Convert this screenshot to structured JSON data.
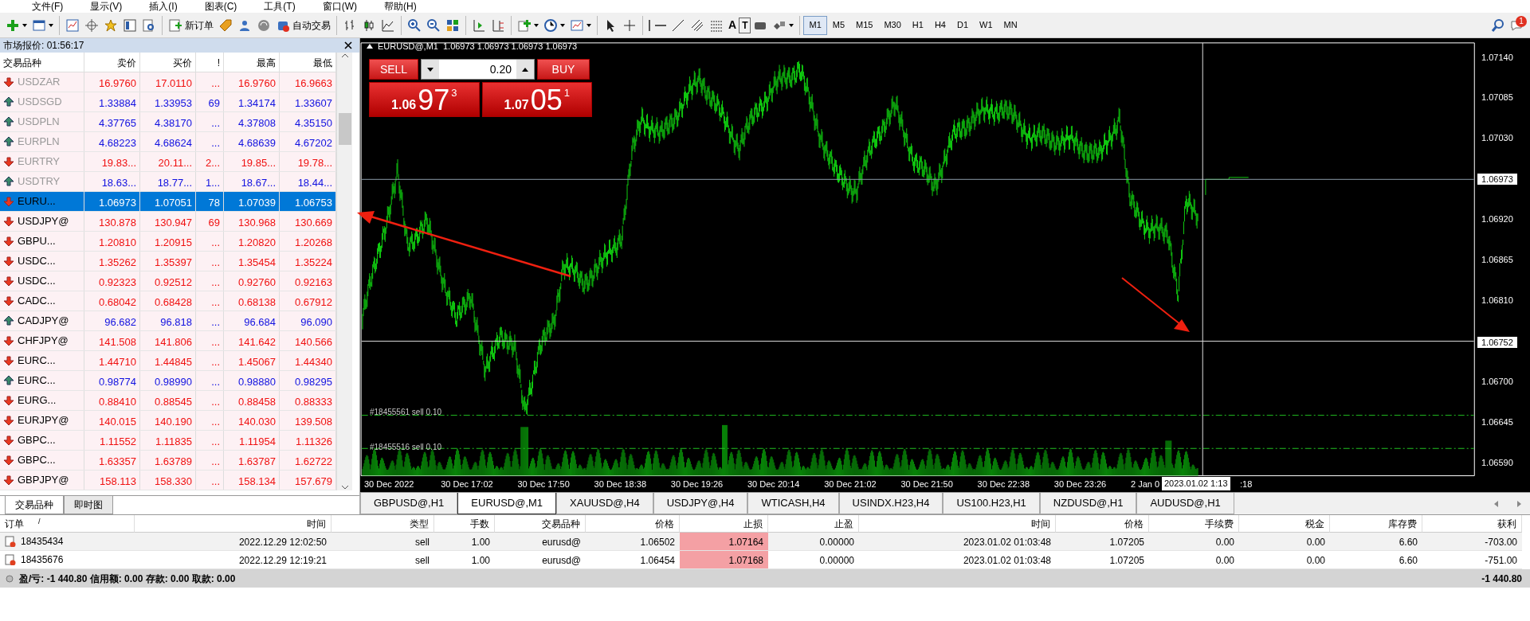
{
  "menu": [
    "文件(F)",
    "显示(V)",
    "插入(I)",
    "图表(C)",
    "工具(T)",
    "窗口(W)",
    "帮助(H)"
  ],
  "toolbar": {
    "new_order": "新订单",
    "auto_trading": "自动交易",
    "text_tool": "A",
    "text_label_tool": "T",
    "notification_count": "1",
    "periods": [
      {
        "label": "M1",
        "selected": true
      },
      {
        "label": "M5",
        "selected": false
      },
      {
        "label": "M15",
        "selected": false
      },
      {
        "label": "M30",
        "selected": false
      },
      {
        "label": "H1",
        "selected": false
      },
      {
        "label": "H4",
        "selected": false
      },
      {
        "label": "D1",
        "selected": false
      },
      {
        "label": "W1",
        "selected": false
      },
      {
        "label": "MN",
        "selected": false
      }
    ]
  },
  "market_watch": {
    "title": "市场报价: 01:56:17",
    "columns": [
      "交易品种",
      "卖价",
      "买价",
      "!",
      "最高",
      "最低"
    ],
    "rows": [
      {
        "symbol": "USDZAR",
        "bid": "16.9760",
        "ask": "17.0110",
        "spread": "...",
        "high": "16.9760",
        "low": "16.9663",
        "rising": false,
        "greyed": true,
        "selected": false
      },
      {
        "symbol": "USDSGD",
        "bid": "1.33884",
        "ask": "1.33953",
        "spread": "69",
        "high": "1.34174",
        "low": "1.33607",
        "rising": true,
        "greyed": true,
        "selected": false
      },
      {
        "symbol": "USDPLN",
        "bid": "4.37765",
        "ask": "4.38170",
        "spread": "...",
        "high": "4.37808",
        "low": "4.35150",
        "rising": true,
        "greyed": true,
        "selected": false
      },
      {
        "symbol": "EURPLN",
        "bid": "4.68223",
        "ask": "4.68624",
        "spread": "...",
        "high": "4.68639",
        "low": "4.67202",
        "rising": true,
        "greyed": true,
        "selected": false
      },
      {
        "symbol": "EURTRY",
        "bid": "19.83...",
        "ask": "20.11...",
        "spread": "2...",
        "high": "19.85...",
        "low": "19.78...",
        "rising": false,
        "greyed": true,
        "selected": false
      },
      {
        "symbol": "USDTRY",
        "bid": "18.63...",
        "ask": "18.77...",
        "spread": "1...",
        "high": "18.67...",
        "low": "18.44...",
        "rising": true,
        "greyed": true,
        "selected": false
      },
      {
        "symbol": "EURU...",
        "bid": "1.06973",
        "ask": "1.07051",
        "spread": "78",
        "high": "1.07039",
        "low": "1.06753",
        "rising": false,
        "greyed": false,
        "selected": true
      },
      {
        "symbol": "USDJPY@",
        "bid": "130.878",
        "ask": "130.947",
        "spread": "69",
        "high": "130.968",
        "low": "130.669",
        "rising": false,
        "greyed": false,
        "selected": false
      },
      {
        "symbol": "GBPU...",
        "bid": "1.20810",
        "ask": "1.20915",
        "spread": "...",
        "high": "1.20820",
        "low": "1.20268",
        "rising": false,
        "greyed": false,
        "selected": false
      },
      {
        "symbol": "USDC...",
        "bid": "1.35262",
        "ask": "1.35397",
        "spread": "...",
        "high": "1.35454",
        "low": "1.35224",
        "rising": false,
        "greyed": false,
        "selected": false
      },
      {
        "symbol": "USDC...",
        "bid": "0.92323",
        "ask": "0.92512",
        "spread": "...",
        "high": "0.92760",
        "low": "0.92163",
        "rising": false,
        "greyed": false,
        "selected": false
      },
      {
        "symbol": "CADC...",
        "bid": "0.68042",
        "ask": "0.68428",
        "spread": "...",
        "high": "0.68138",
        "low": "0.67912",
        "rising": false,
        "greyed": false,
        "selected": false
      },
      {
        "symbol": "CADJPY@",
        "bid": "96.682",
        "ask": "96.818",
        "spread": "...",
        "high": "96.684",
        "low": "96.090",
        "rising": true,
        "greyed": false,
        "selected": false
      },
      {
        "symbol": "CHFJPY@",
        "bid": "141.508",
        "ask": "141.806",
        "spread": "...",
        "high": "141.642",
        "low": "140.566",
        "rising": false,
        "greyed": false,
        "selected": false
      },
      {
        "symbol": "EURC...",
        "bid": "1.44710",
        "ask": "1.44845",
        "spread": "...",
        "high": "1.45067",
        "low": "1.44340",
        "rising": false,
        "greyed": false,
        "selected": false
      },
      {
        "symbol": "EURC...",
        "bid": "0.98774",
        "ask": "0.98990",
        "spread": "...",
        "high": "0.98880",
        "low": "0.98295",
        "rising": true,
        "greyed": false,
        "selected": false
      },
      {
        "symbol": "EURG...",
        "bid": "0.88410",
        "ask": "0.88545",
        "spread": "...",
        "high": "0.88458",
        "low": "0.88333",
        "rising": false,
        "greyed": false,
        "selected": false
      },
      {
        "symbol": "EURJPY@",
        "bid": "140.015",
        "ask": "140.190",
        "spread": "...",
        "high": "140.030",
        "low": "139.508",
        "rising": false,
        "greyed": false,
        "selected": false
      },
      {
        "symbol": "GBPC...",
        "bid": "1.11552",
        "ask": "1.11835",
        "spread": "...",
        "high": "1.11954",
        "low": "1.11326",
        "rising": false,
        "greyed": false,
        "selected": false
      },
      {
        "symbol": "GBPC...",
        "bid": "1.63357",
        "ask": "1.63789",
        "spread": "...",
        "high": "1.63787",
        "low": "1.62722",
        "rising": false,
        "greyed": false,
        "selected": false
      },
      {
        "symbol": "GBPJPY@",
        "bid": "158.113",
        "ask": "158.330",
        "spread": "...",
        "high": "158.134",
        "low": "157.679",
        "rising": false,
        "greyed": false,
        "selected": false
      }
    ],
    "tabs": [
      {
        "label": "交易品种",
        "selected": true
      },
      {
        "label": "即时图",
        "selected": false
      }
    ]
  },
  "chart": {
    "title": "EURUSD@,M1",
    "ohlc": "1.06973 1.06973 1.06973 1.06973",
    "one_click": {
      "sell_label": "SELL",
      "buy_label": "BUY",
      "volume": "0.20",
      "sell_price": {
        "prefix": "1.06",
        "big": "97",
        "sup": "3"
      },
      "buy_price": {
        "prefix": "1.07",
        "big": "05",
        "sup": "1"
      }
    },
    "order_lines": [
      "#18455561 sell 0.10",
      "#18455516 sell 0.10"
    ],
    "price_ticks": [
      "1.07140",
      "1.07085",
      "1.07030",
      "1.06920",
      "1.06865",
      "1.06810",
      "1.06700",
      "1.06645",
      "1.06590"
    ],
    "bid_marker": "1.06973",
    "crosshair_price": "1.06752",
    "time_ticks": [
      "30 Dec 2022",
      "30 Dec 17:02",
      "30 Dec 17:50",
      "30 Dec 18:38",
      "30 Dec 19:26",
      "30 Dec 20:14",
      "30 Dec 21:02",
      "30 Dec 21:50",
      "30 Dec 22:38",
      "30 Dec 23:26",
      "2 Jan 0"
    ],
    "crosshair_time": "2023.01.02 1:13",
    "time_tail": ":18"
  },
  "chart_tabs": [
    {
      "label": "GBPUSD@,H1",
      "selected": false
    },
    {
      "label": "EURUSD@,M1",
      "selected": true
    },
    {
      "label": "XAUUSD@,H4",
      "selected": false
    },
    {
      "label": "USDJPY@,H4",
      "selected": false
    },
    {
      "label": "WTICASH,H4",
      "selected": false
    },
    {
      "label": "USINDX.H23,H4",
      "selected": false
    },
    {
      "label": "US100.H23,H1",
      "selected": false
    },
    {
      "label": "NZDUSD@,H1",
      "selected": false
    },
    {
      "label": "AUDUSD@,H1",
      "selected": false
    }
  ],
  "terminal": {
    "columns": [
      "订单",
      "时间",
      "类型",
      "手数",
      "交易品种",
      "价格",
      "止损",
      "止盈",
      "时间",
      "价格",
      "手续费",
      "税金",
      "库存费",
      "获利"
    ],
    "sort_indicator": "/",
    "rows": [
      {
        "cells": [
          "18435434",
          "2022.12.29 12:02:50",
          "sell",
          "1.00",
          "eurusd@",
          "1.06502",
          "1.07164",
          "0.00000",
          "2023.01.02 01:03:48",
          "1.07205",
          "0.00",
          "0.00",
          "6.60",
          "-703.00"
        ],
        "sl_alert": true
      },
      {
        "cells": [
          "18435676",
          "2022.12.29 12:19:21",
          "sell",
          "1.00",
          "eurusd@",
          "1.06454",
          "1.07168",
          "0.00000",
          "2023.01.02 01:03:48",
          "1.07205",
          "0.00",
          "0.00",
          "6.60",
          "-751.00"
        ],
        "sl_alert": true
      }
    ],
    "summary": "盈/亏: -1 440.80 信用额: 0.00 存款: 0.00 取款: 0.00",
    "total": "-1 440.80"
  }
}
